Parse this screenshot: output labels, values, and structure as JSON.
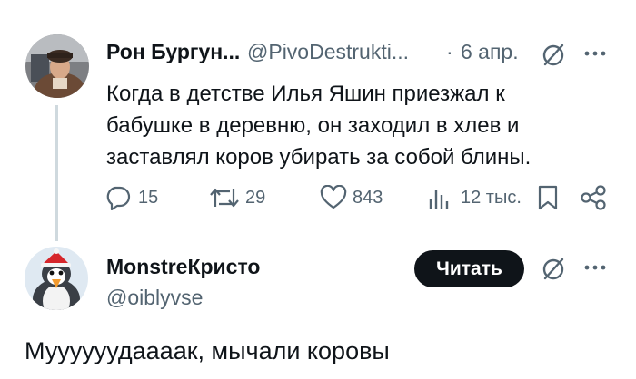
{
  "tweet": {
    "author_name": "Рон Бургун...",
    "author_handle": "@PivoDestrukti...",
    "separator": "·",
    "date": "6 апр.",
    "text_lines": [
      "Когда в детстве Илья Яшин приезжал к",
      "бабушке в деревню, он заходил в хлев и",
      "заставлял коров убирать за собой блины."
    ],
    "actions": {
      "replies": "15",
      "retweets": "29",
      "likes": "843",
      "views": "12 тыс."
    }
  },
  "reply": {
    "author_name": "MonstreКристо",
    "author_handle": "@oiblyvse",
    "follow_label": "Читать",
    "text": "Муууууудаааак, мычали коровы"
  },
  "icons": {
    "grok": "grok-icon",
    "more": "more-icon",
    "reply": "reply-icon",
    "retweet": "retweet-icon",
    "like": "heart-icon",
    "views": "views-icon",
    "bookmark": "bookmark-icon",
    "share": "share-icon"
  }
}
